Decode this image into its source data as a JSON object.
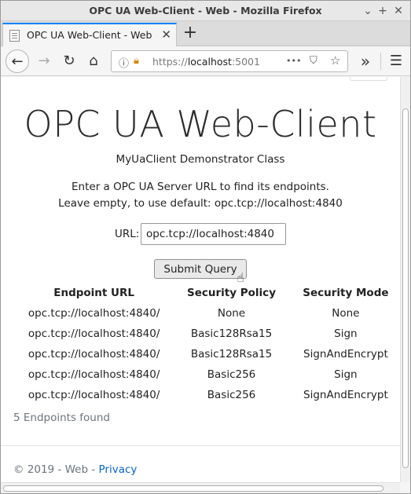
{
  "window": {
    "title": "OPC UA Web-Client - Web - Mozilla Firefox"
  },
  "tabs": [
    {
      "label": "OPC UA Web-Client - Web"
    }
  ],
  "browser": {
    "url_scheme": "https://",
    "url_host": "localhost",
    "url_port": ":5001",
    "overflow_label": "•••"
  },
  "page": {
    "headline": "OPC UA Web-Client",
    "subtitle": "MyUaClient Demonstrator Class",
    "instruction_line1": "Enter a OPC UA Server URL to find its endpoints.",
    "instruction_line2": "Leave empty, to use default: opc.tcp://localhost:4840",
    "url_label": "URL:",
    "url_value": "opc.tcp://localhost:4840",
    "submit_label": "Submit Query",
    "table": {
      "headers": [
        "Endpoint URL",
        "Security Policy",
        "Security Mode"
      ],
      "rows": [
        [
          "opc.tcp://localhost:4840/",
          "None",
          "None"
        ],
        [
          "opc.tcp://localhost:4840/",
          "Basic128Rsa15",
          "Sign"
        ],
        [
          "opc.tcp://localhost:4840/",
          "Basic128Rsa15",
          "SignAndEncrypt"
        ],
        [
          "opc.tcp://localhost:4840/",
          "Basic256",
          "Sign"
        ],
        [
          "opc.tcp://localhost:4840/",
          "Basic256",
          "SignAndEncrypt"
        ]
      ]
    },
    "found_text": "5 Endpoints found",
    "footer_text": "© 2019 - Web - ",
    "footer_link": "Privacy"
  },
  "colors": {
    "tab_accent": "#0a84ff",
    "link": "#0366d6",
    "muted_text": "#6c757d"
  },
  "icons": [
    "page-icon",
    "close-icon",
    "plus-icon",
    "back-arrow-icon",
    "forward-arrow-icon",
    "reload-icon",
    "home-icon",
    "info-icon",
    "lock-icon",
    "more-icon",
    "pocket-icon",
    "star-icon",
    "overflow-chevrons-icon",
    "hamburger-menu-icon",
    "hand-cursor-icon"
  ]
}
